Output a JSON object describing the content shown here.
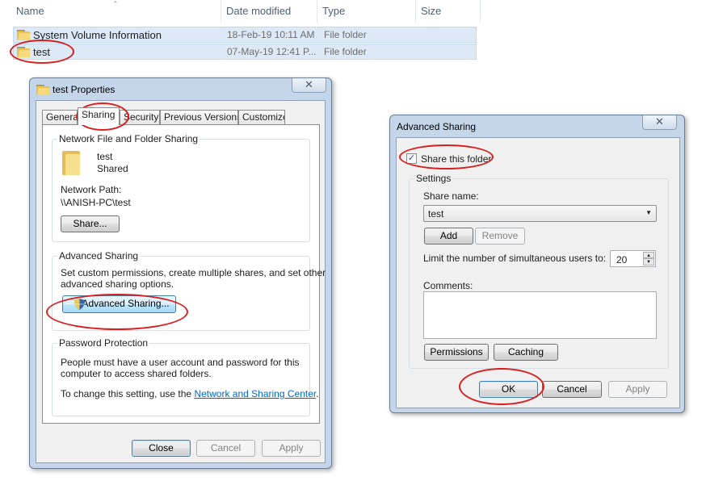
{
  "explorer": {
    "columns": [
      "Name",
      "Date modified",
      "Type",
      "Size"
    ],
    "rows": [
      {
        "name": "System Volume Information",
        "date": "18-Feb-19 10:11 AM",
        "type": "File folder"
      },
      {
        "name": "test",
        "date": "07-May-19 12:41 P...",
        "type": "File folder"
      }
    ]
  },
  "props_dialog": {
    "title": "test Properties",
    "close_glyph": "✕",
    "tabs": [
      "General",
      "Sharing",
      "Security",
      "Previous Versions",
      "Customize"
    ],
    "nfs_group": "Network File and Folder Sharing",
    "folder_name": "test",
    "folder_status": "Shared",
    "network_path_label": "Network Path:",
    "network_path": "\\\\ANISH-PC\\test",
    "share_button": "Share...",
    "adv_group": "Advanced Sharing",
    "adv_desc_1": "Set custom permissions, create multiple shares, and set other",
    "adv_desc_2": "advanced sharing options.",
    "adv_button": "Advanced Sharing...",
    "pw_group": "Password Protection",
    "pw_desc_1": "People must have a user account and password for this",
    "pw_desc_2": "computer to access shared folders.",
    "pw_change_prefix": "To change this setting, use the ",
    "pw_link": "Network and Sharing Center",
    "pw_suffix": ".",
    "close_button": "Close",
    "cancel_button": "Cancel",
    "apply_button": "Apply"
  },
  "adv_dialog": {
    "title": "Advanced Sharing",
    "close_glyph": "✕",
    "share_checkbox_label": "Share this folder",
    "share_checked": true,
    "checkmark": "✓",
    "settings_group": "Settings",
    "share_name_label": "Share name:",
    "share_name_value": "test",
    "dropdown_glyph": "▼",
    "add_button": "Add",
    "remove_button": "Remove",
    "limit_label": "Limit the number of simultaneous users to:",
    "limit_value": "20",
    "spin_up": "▲",
    "spin_down": "▼",
    "comments_label": "Comments:",
    "comments_value": "",
    "permissions_button": "Permissions",
    "caching_button": "Caching",
    "ok_button": "OK",
    "cancel_button": "Cancel",
    "apply_button": "Apply"
  },
  "colors": {
    "annotation_red": "#d81e1e",
    "selection_blue": "#dde9f7",
    "link_blue": "#0066cc"
  }
}
